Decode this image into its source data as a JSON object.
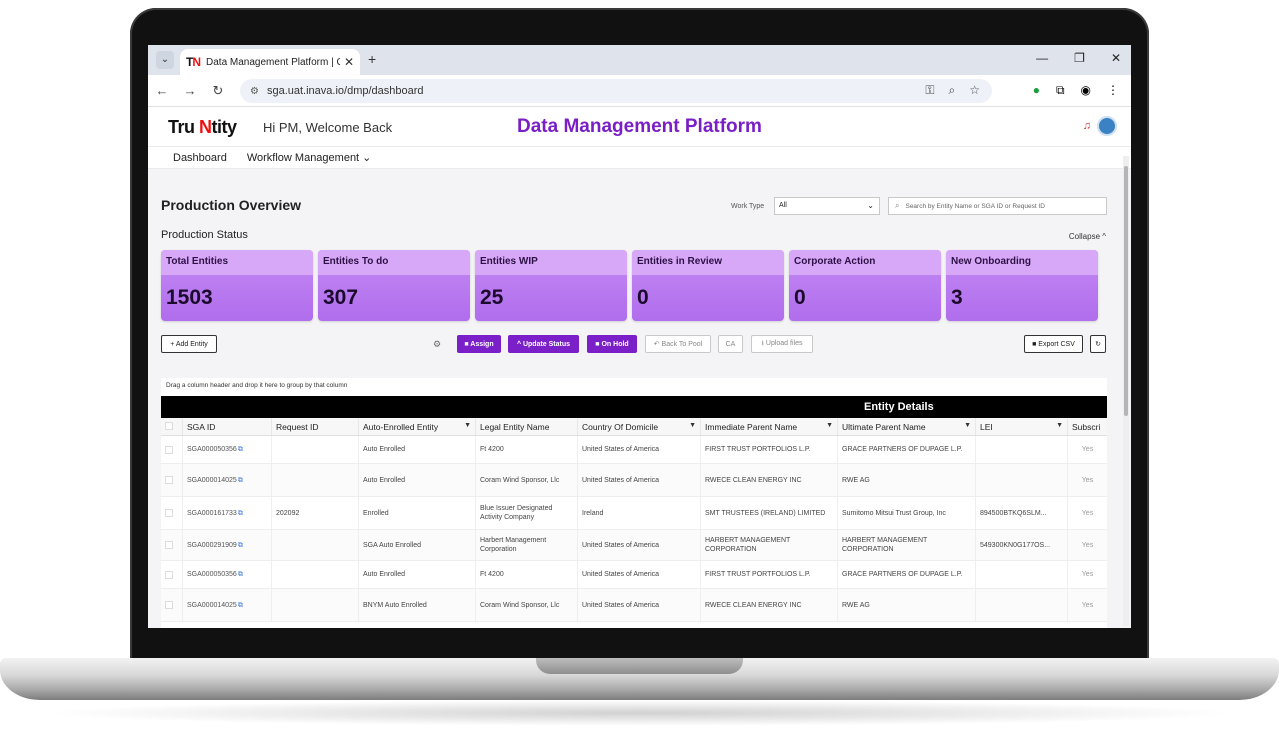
{
  "browser": {
    "tab_title": "Data Management Platform | C",
    "favicon_text_a": "T",
    "favicon_text_b": "N",
    "url": "sga.uat.inava.io/dmp/dashboard"
  },
  "header": {
    "logo_part1": "Tru",
    "logo_part2": "N",
    "logo_part3": "tity",
    "welcome": "Hi PM, Welcome Back",
    "title": "Data Management Platform"
  },
  "nav": {
    "items": [
      {
        "label": "Dashboard"
      },
      {
        "label": "Workflow Management ⌄"
      }
    ]
  },
  "page": {
    "title": "Production Overview",
    "work_type_label": "Work Type",
    "work_type_value": "All",
    "search_placeholder": "Search by Entity Name or SGA ID or Request ID",
    "section_title": "Production Status",
    "collapse_label": "Collapse ^"
  },
  "cards": [
    {
      "label": "Total Entities",
      "value": "1503"
    },
    {
      "label": "Entities To do",
      "value": "307"
    },
    {
      "label": "Entities WIP",
      "value": "25"
    },
    {
      "label": "Entities in Review",
      "value": "0"
    },
    {
      "label": "Corporate Action",
      "value": "0"
    },
    {
      "label": "New Onboarding",
      "value": "3"
    }
  ],
  "toolbar": {
    "add_entity": "+ Add Entity",
    "assign": "■ Assign",
    "update_status": "^ Update Status",
    "on_hold": "■ On Hold",
    "back_to_pool": "↶ Back To Pool",
    "ca": "CA",
    "upload_files": "⭳ Upload files",
    "export_csv": "■ Export CSV",
    "refresh": "↻"
  },
  "grid": {
    "drag_hint": "Drag a column header and drop it here to group by that column",
    "banner": "Entity Details",
    "columns": [
      "SGA ID",
      "Request ID",
      "Auto-Enrolled Entity",
      "Legal Entity Name",
      "Country Of Domicile",
      "Immediate Parent Name",
      "Ultimate Parent Name",
      "LEI",
      "Subscri"
    ],
    "rows": [
      [
        "SGA000050356",
        "",
        "Auto Enrolled",
        "Ft 4200",
        "United States of America",
        "FIRST TRUST PORTFOLIOS L.P.",
        "GRACE PARTNERS OF DUPAGE L.P.",
        "",
        "Yes"
      ],
      [
        "SGA000014025",
        "",
        "Auto Enrolled",
        "Coram Wind Sponsor, Llc",
        "United States of America",
        "RWECE CLEAN ENERGY INC",
        "RWE AG",
        "",
        "Yes"
      ],
      [
        "SGA000161733",
        "202092",
        "Enrolled",
        "Blue Issuer Designated Activity Company",
        "Ireland",
        "SMT TRUSTEES (IRELAND) LIMITED",
        "Sumitomo Mitsui Trust Group, Inc",
        "894500BTKQ6SLM...",
        "Yes"
      ],
      [
        "SGA000291909",
        "",
        "SGA Auto Enrolled",
        "Harbert Management Corporation",
        "United States of America",
        "HARBERT MANAGEMENT CORPORATION",
        "HARBERT MANAGEMENT CORPORATION",
        "549300KN0G177OS...",
        "Yes"
      ],
      [
        "SGA000050356",
        "",
        "Auto Enrolled",
        "Ft 4200",
        "United States of America",
        "FIRST TRUST PORTFOLIOS L.P.",
        "GRACE PARTNERS OF DUPAGE L.P.",
        "",
        "Yes"
      ],
      [
        "SGA000014025",
        "",
        "BNYM Auto Enrolled",
        "Coram Wind Sponsor, Llc",
        "United States of America",
        "RWECE CLEAN ENERGY INC",
        "RWE AG",
        "",
        "Yes"
      ]
    ]
  },
  "colors": {
    "accent": "#7b1fc9",
    "card": "#c48af2"
  }
}
